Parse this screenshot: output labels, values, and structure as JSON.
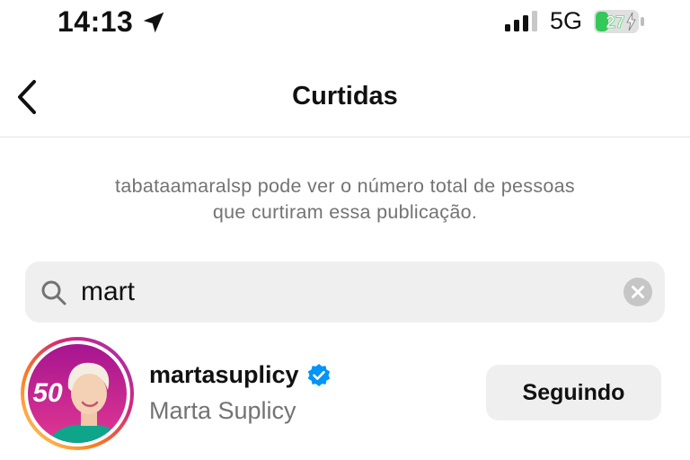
{
  "status_bar": {
    "time": "14:13",
    "network": "5G",
    "battery": "27",
    "battery_color": "#34c759",
    "icons": [
      "location-arrow-icon",
      "signal-bars-icon",
      "battery-charging-icon"
    ]
  },
  "nav": {
    "title": "Curtidas",
    "back_icon": "chevron-left-icon"
  },
  "info": {
    "line1": "tabataamaralsp pode ver o número total de pessoas",
    "line2": "que curtiram essa publicação."
  },
  "search": {
    "value": "mart",
    "icons": [
      "search-icon",
      "clear-icon"
    ]
  },
  "results": [
    {
      "avatar_badge": "50",
      "username": "martasuplicy",
      "full_name": "Marta Suplicy",
      "verified": true,
      "button_label": "Seguindo"
    }
  ],
  "colors": {
    "verified": "#0095f6",
    "muted_text": "#737373",
    "field_bg": "#efefef"
  }
}
